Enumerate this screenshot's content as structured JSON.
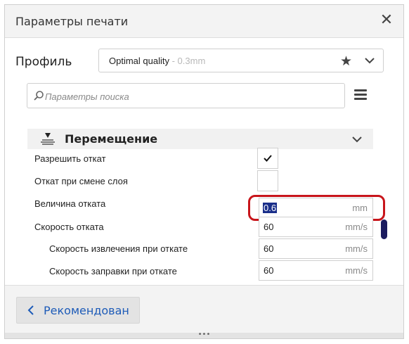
{
  "window": {
    "title": "Параметры печати"
  },
  "profile": {
    "label": "Профиль",
    "name": "Optimal quality",
    "suffix": " - 0.3mm"
  },
  "search": {
    "placeholder": "Параметры поиска",
    "value": ""
  },
  "section": {
    "title": "Перемещение"
  },
  "settings": [
    {
      "label": "Разрешить откат",
      "type": "checkbox",
      "checked": true
    },
    {
      "label": "Откат при смене слоя",
      "type": "checkbox",
      "checked": false
    },
    {
      "label": "Величина отката",
      "type": "number",
      "value": "0.6",
      "unit": "mm",
      "selected": true
    },
    {
      "label": "Скорость отката",
      "type": "number",
      "value": "60",
      "unit": "mm/s"
    },
    {
      "label": "Скорость извлечения при откате",
      "type": "number",
      "value": "60",
      "unit": "mm/s"
    },
    {
      "label": "Скорость заправки при откате",
      "type": "number",
      "value": "60",
      "unit": "mm/s"
    }
  ],
  "footer": {
    "recommended_label": "Рекомендован",
    "grip": "•••"
  },
  "colors": {
    "accent": "#1d5bb8",
    "highlight": "#c8151b",
    "selection": "#1a2f8a",
    "scrollbar": "#1b1b5e"
  }
}
